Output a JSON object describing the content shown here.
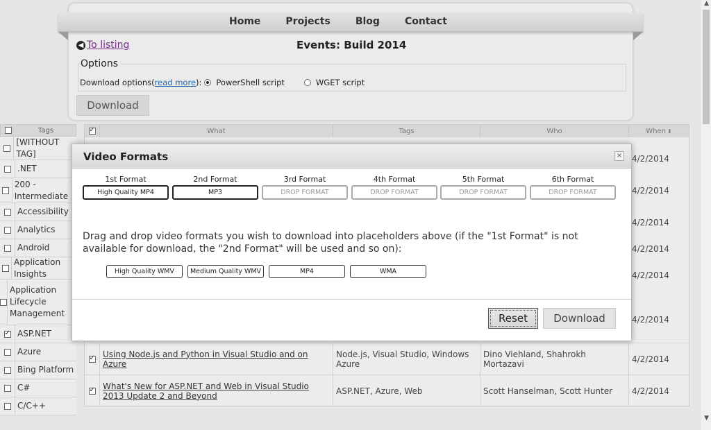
{
  "nav": {
    "home": "Home",
    "projects": "Projects",
    "blog": "Blog",
    "contact": "Contact"
  },
  "back_link": "To listing",
  "event_title": "Events: Build 2014",
  "options": {
    "legend": "Options",
    "prefix": "Download options(",
    "read_more": "read more",
    "suffix": "):",
    "powershell": "PowerShell script",
    "wget": "WGET script",
    "selected": "PowerShell script",
    "download": "Download"
  },
  "tags_panel": {
    "header": "Tags",
    "items": [
      {
        "label": "[WITHOUT TAG]",
        "checked": false
      },
      {
        "label": ".NET",
        "checked": false
      },
      {
        "label": "200 - Intermediate",
        "checked": false
      },
      {
        "label": "Accessibility",
        "checked": false
      },
      {
        "label": "Analytics",
        "checked": false
      },
      {
        "label": "Android",
        "checked": false
      },
      {
        "label": "Application Insights",
        "checked": false
      },
      {
        "label": "Application Lifecycle Management",
        "checked": false
      },
      {
        "label": "ASP.NET",
        "checked": true
      },
      {
        "label": "Azure",
        "checked": false
      },
      {
        "label": "Bing Platform",
        "checked": false
      },
      {
        "label": "C#",
        "checked": false
      },
      {
        "label": "C/C++",
        "checked": false
      }
    ]
  },
  "table": {
    "headers": {
      "what": "What",
      "tags": "Tags",
      "who": "Who",
      "when": "When"
    },
    "sort_arrow": "⬍",
    "bg_dates": [
      "4/2/2014",
      "4/2/2014",
      "4/2/2014",
      "4/2/2014",
      "4/2/2014",
      "4/2/2014"
    ],
    "rows": [
      {
        "what": "Using Node.js and Python in Visual Studio and on Azure",
        "tags": "Node.js, Visual Studio, Windows Azure",
        "who": "Dino Viehland, Shahrokh Mortazavi",
        "when": "4/2/2014"
      },
      {
        "what": "What's New for ASP.NET and Web in Visual Studio 2013 Update 2 and Beyond",
        "tags": "ASP.NET, Azure, Web",
        "who": "Scott Hanselman, Scott Hunter",
        "when": "4/2/2014"
      }
    ]
  },
  "modal": {
    "title": "Video Formats",
    "close": "×",
    "slots": [
      {
        "label": "1st Format",
        "value": "High Quality MP4"
      },
      {
        "label": "2nd Format",
        "value": "MP3"
      },
      {
        "label": "3rd Format",
        "value": "DROP FORMAT"
      },
      {
        "label": "4th Format",
        "value": "DROP FORMAT"
      },
      {
        "label": "5th Format",
        "value": "DROP FORMAT"
      },
      {
        "label": "6th Format",
        "value": "DROP FORMAT"
      }
    ],
    "instructions": "Drag and drop video formats you wish to download into placeholders above (if the \"1st Format\" is not available for download, the \"2nd Format\" will be used and so on):",
    "available": [
      "High Quality WMV",
      "Medium Quality WMV",
      "MP4",
      "WMA"
    ],
    "reset": "Reset",
    "download": "Download"
  }
}
